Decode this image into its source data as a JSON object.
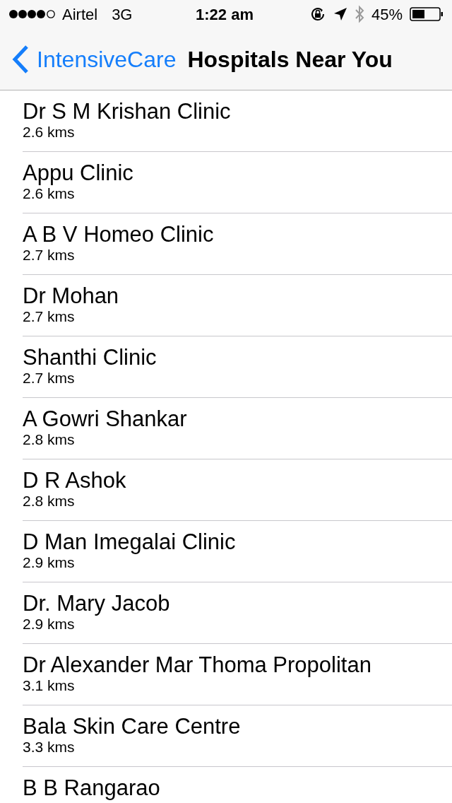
{
  "status_bar": {
    "carrier": "Airtel",
    "network": "3G",
    "time": "1:22 am",
    "battery": "45%"
  },
  "nav_bar": {
    "back": "IntensiveCare",
    "title": "Hospitals Near You"
  },
  "hospitals": [
    {
      "name": "Dr S M Krishan Clinic",
      "distance": "2.6 kms"
    },
    {
      "name": "Appu Clinic",
      "distance": "2.6 kms"
    },
    {
      "name": "A B V Homeo Clinic",
      "distance": "2.7 kms"
    },
    {
      "name": "Dr Mohan",
      "distance": "2.7 kms"
    },
    {
      "name": "Shanthi Clinic",
      "distance": "2.7 kms"
    },
    {
      "name": "A Gowri Shankar",
      "distance": "2.8 kms"
    },
    {
      "name": "D R Ashok",
      "distance": "2.8 kms"
    },
    {
      "name": "D Man Imegalai Clinic",
      "distance": "2.9 kms"
    },
    {
      "name": "Dr. Mary Jacob",
      "distance": "2.9 kms"
    },
    {
      "name": "Dr Alexander Mar Thoma Propolitan",
      "distance": "3.1 kms"
    },
    {
      "name": "Bala Skin Care Centre",
      "distance": "3.3 kms"
    },
    {
      "name": "B B Rangarao"
    }
  ]
}
